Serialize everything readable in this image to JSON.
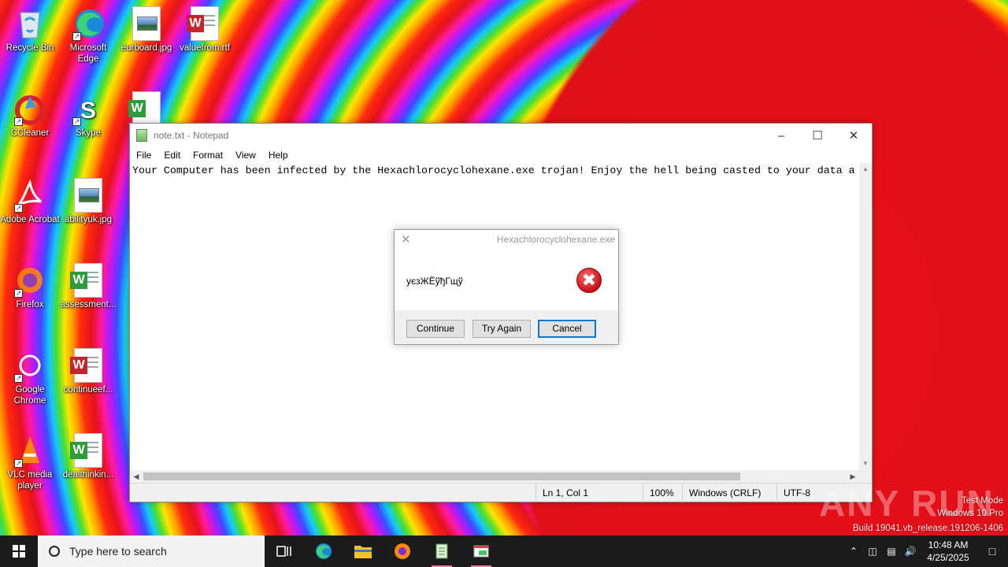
{
  "desktop": {
    "icons": [
      {
        "label": "Recycle Bin",
        "icon": "recycle-bin-icon"
      },
      {
        "label": "Microsoft Edge",
        "icon": "edge-icon"
      },
      {
        "label": "eurboard.jpg",
        "icon": "image-file-icon"
      },
      {
        "label": "valuefrom.rtf",
        "icon": "word-document-icon"
      },
      {
        "label": "CCleaner",
        "icon": "ccleaner-icon"
      },
      {
        "label": "Skype",
        "icon": "skype-icon"
      },
      {
        "label": "Adobe Acrobat",
        "icon": "acrobat-icon"
      },
      {
        "label": "abilityuk.jpg",
        "icon": "image-file-icon"
      },
      {
        "label": "Firefox",
        "icon": "firefox-icon"
      },
      {
        "label": "assessment...",
        "icon": "word-document-icon"
      },
      {
        "label": "Google Chrome",
        "icon": "chrome-icon"
      },
      {
        "label": "continueef...",
        "icon": "word-document-icon"
      },
      {
        "label": "VLC media player",
        "icon": "vlc-icon"
      },
      {
        "label": "dealthinkin...",
        "icon": "word-document-icon"
      }
    ]
  },
  "notepad": {
    "title": "note.txt - Notepad",
    "menu": [
      "File",
      "Edit",
      "Format",
      "View",
      "Help"
    ],
    "content": "Your Computer has been infected by the Hexachlorocyclohexane.exe trojan! Enjoy the hell being casted to your data a",
    "status": {
      "position": "Ln 1, Col 1",
      "zoom": "100%",
      "line_ending": "Windows (CRLF)",
      "encoding": "UTF-8"
    }
  },
  "dialog": {
    "title": "Hexachlorocyclohexane.exe",
    "message": "уєзЖЁўђГщў",
    "buttons": {
      "continue": "Continue",
      "try_again": "Try Again",
      "cancel": "Cancel"
    }
  },
  "watermark": {
    "brand": "ANY RUN",
    "line1": "Test Mode",
    "line2": "Windows 10 Pro",
    "line3": "Build 19041.vb_release.191206-1406"
  },
  "taskbar": {
    "search_placeholder": "Type here to search",
    "time": "10:48 AM",
    "date": "4/25/2025"
  }
}
